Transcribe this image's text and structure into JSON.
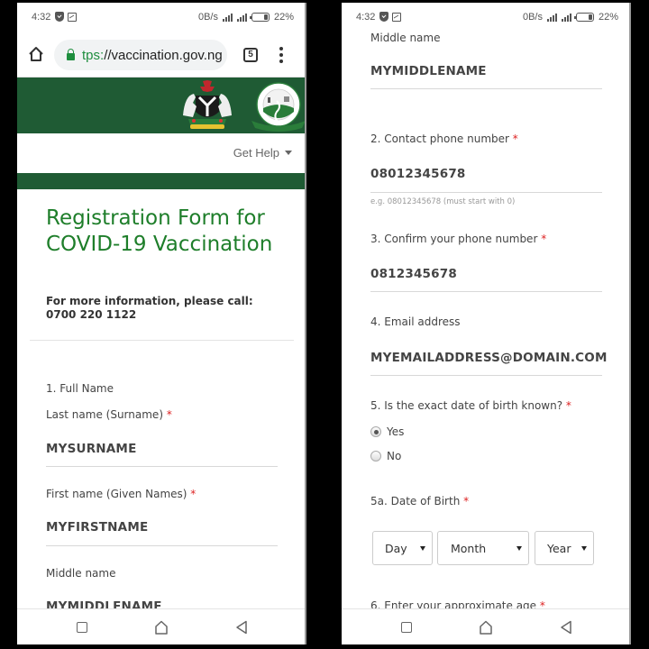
{
  "status_bar": {
    "time": "4:32",
    "network_speed": "0B/s",
    "battery": "22%"
  },
  "browser": {
    "url_scheme": "tps:",
    "url_rest": "//vaccination.gov.ng",
    "tab_count": "5"
  },
  "site": {
    "get_help": "Get Help",
    "brand_color": "#1f5b34",
    "title_color": "#1e7e2a"
  },
  "form": {
    "title": "Registration Form for COVID-19 Vaccination",
    "info_line1": "For more information, please call:",
    "info_line2": "0700 220 1122",
    "q1_label": "1. Full Name",
    "last_name_label": "Last name (Surname)",
    "last_name_value": "MYSURNAME",
    "first_name_label": "First name (Given Names)",
    "first_name_value": "MYFIRSTNAME",
    "middle_name_label": "Middle name",
    "middle_name_value": "MYMIDDLENAME",
    "q2_label": "2. Contact phone number",
    "phone_value": "08012345678",
    "phone_hint": "e.g. 08012345678 (must start with 0)",
    "q3_label": "3. Confirm your phone number",
    "confirm_phone_value": "0812345678",
    "q4_label": "4. Email address",
    "email_value": "MYEMAILADDRESS@DOMAIN.COM",
    "q5_label": "5. Is the exact date of birth known?",
    "q5_options": [
      "Yes",
      "No"
    ],
    "q5_selected": "Yes",
    "q5a_label": "5a. Date of Birth",
    "dob_day": "Day",
    "dob_month": "Month",
    "dob_year": "Year",
    "q6_label": "6. Enter your approximate age",
    "required_mark": "*"
  }
}
